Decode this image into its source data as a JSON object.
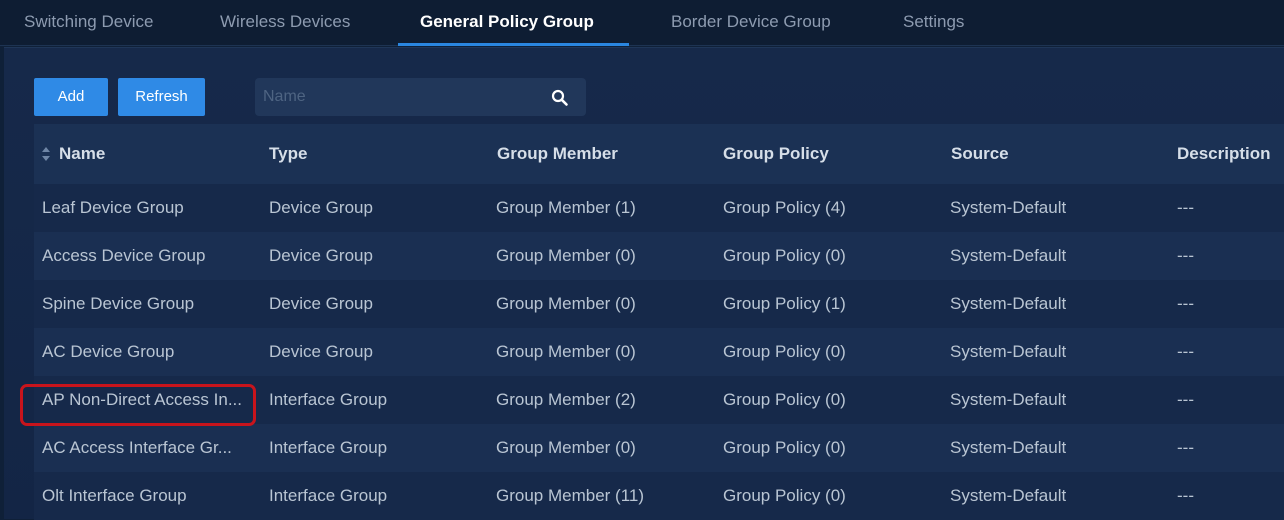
{
  "tabs": [
    {
      "label": "Switching Device"
    },
    {
      "label": "Wireless Devices"
    },
    {
      "label": "General Policy Group",
      "active": true
    },
    {
      "label": "Border Device Group"
    },
    {
      "label": "Settings"
    }
  ],
  "toolbar": {
    "add_label": "Add",
    "refresh_label": "Refresh"
  },
  "search": {
    "placeholder": "Name",
    "value": ""
  },
  "table": {
    "columns": [
      "Name",
      "Type",
      "Group Member",
      "Group Policy",
      "Source",
      "Description"
    ],
    "rows": [
      [
        "Leaf Device Group",
        "Device Group",
        "Group Member (1)",
        "Group Policy (4)",
        "System-Default",
        "---"
      ],
      [
        "Access Device Group",
        "Device Group",
        "Group Member (0)",
        "Group Policy (0)",
        "System-Default",
        "---"
      ],
      [
        "Spine Device Group",
        "Device Group",
        "Group Member (0)",
        "Group Policy (1)",
        "System-Default",
        "---"
      ],
      [
        "AC Device Group",
        "Device Group",
        "Group Member (0)",
        "Group Policy (0)",
        "System-Default",
        "---"
      ],
      [
        "AP Non-Direct Access In...",
        "Interface Group",
        "Group Member (2)",
        "Group Policy (0)",
        "System-Default",
        "---"
      ],
      [
        "AC Access Interface Gr...",
        "Interface Group",
        "Group Member (0)",
        "Group Policy (0)",
        "System-Default",
        "---"
      ],
      [
        "Olt Interface Group",
        "Interface Group",
        "Group Member (11)",
        "Group Policy (0)",
        "System-Default",
        "---"
      ]
    ]
  },
  "colors": {
    "accent": "#2f8ae6",
    "highlight": "#c8141c",
    "background": "#0f2038"
  }
}
